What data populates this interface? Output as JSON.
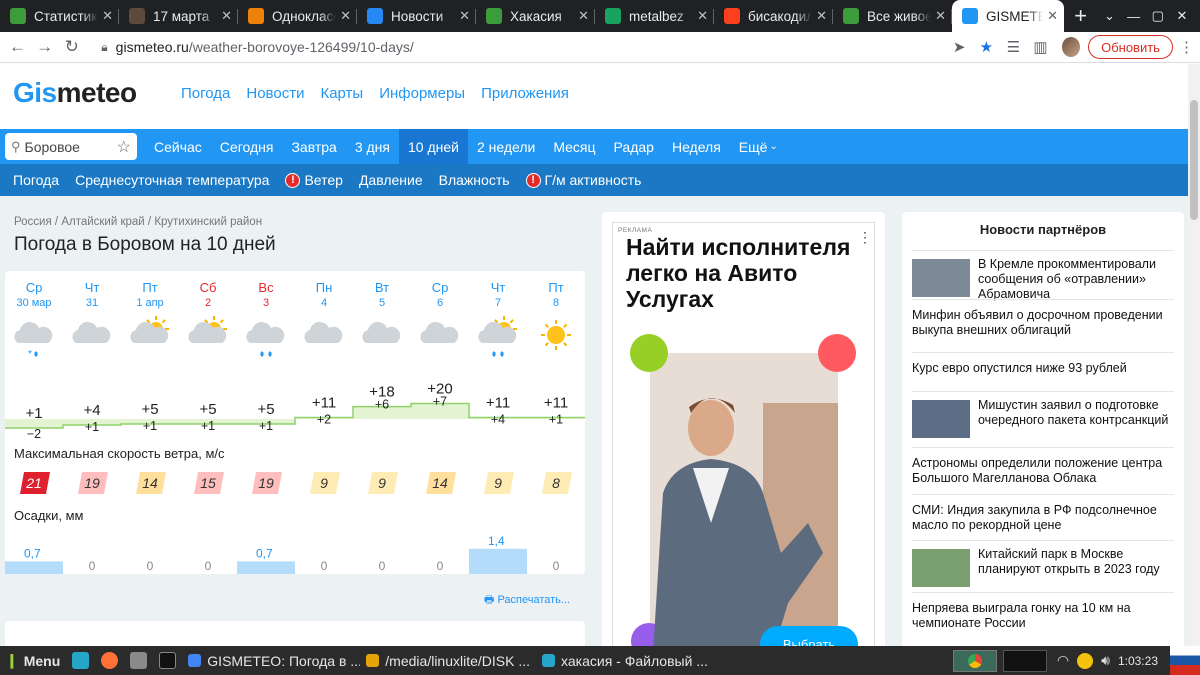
{
  "browser": {
    "tabs": [
      {
        "title": "Статистика",
        "icon": "green-ball-icon",
        "color": "#3c9c3c"
      },
      {
        "title": "17 марта",
        "icon": "photo-icon",
        "color": "#5c4a3a"
      },
      {
        "title": "Одноклассники",
        "icon": "ok-icon",
        "color": "#ee8208"
      },
      {
        "title": "Новости",
        "icon": "vk-icon",
        "color": "#2787f5"
      },
      {
        "title": "Хакасия",
        "icon": "green-ball-icon",
        "color": "#3c9c3c"
      },
      {
        "title": "metalbez",
        "icon": "check-icon",
        "color": "#1aa260"
      },
      {
        "title": "бисакодил",
        "icon": "yandex-icon",
        "color": "#fc3f1d"
      },
      {
        "title": "Все живое",
        "icon": "green-ball-icon",
        "color": "#3c9c3c"
      },
      {
        "title": "GISMETEO",
        "icon": "gismeteo-drop-icon",
        "color": "#2196f3",
        "active": true
      }
    ],
    "url_domain": "gismeteo.ru",
    "url_path": "/weather-borovoye-126499/10-days/",
    "update_button": "Обновить"
  },
  "site": {
    "logo_part1": "Gis",
    "logo_part2": "meteo",
    "nav": [
      "Погода",
      "Новости",
      "Карты",
      "Информеры",
      "Приложения"
    ],
    "search_value": "Боровое",
    "period_tabs": [
      "Сейчас",
      "Сегодня",
      "Завтра",
      "3 дня",
      "10 дней",
      "2 недели",
      "Месяц",
      "Радар",
      "Неделя",
      "Ещё"
    ],
    "active_period": "10 дней",
    "param_tabs": [
      {
        "label": "Погода",
        "warn": false
      },
      {
        "label": "Среднесуточная температура",
        "warn": false
      },
      {
        "label": "Ветер",
        "warn": true
      },
      {
        "label": "Давление",
        "warn": false
      },
      {
        "label": "Влажность",
        "warn": false
      },
      {
        "label": "Г/м активность",
        "warn": true
      }
    ],
    "breadcrumb": [
      "Россия",
      "Алтайский край",
      "Крутихинский район"
    ],
    "page_title": "Погода в Боровом на 10 дней",
    "wind_label": "Максимальная скорость ветра, м/с",
    "precip_label": "Осадки, мм",
    "print_label": "Распечатать..."
  },
  "chart_data": {
    "type": "table",
    "days": [
      {
        "dow": "Ср",
        "date": "30 мар",
        "weekend": false,
        "icon": "cloud-snow",
        "tmax": "+1",
        "tmin": "−2",
        "tmax_val": 1,
        "tmin_val": -2,
        "wind": "21",
        "precip": "0,7",
        "precip_val": 0.7
      },
      {
        "dow": "Чт",
        "date": "31",
        "weekend": false,
        "icon": "cloud",
        "tmax": "+4",
        "tmin": "+1",
        "tmax_val": 4,
        "tmin_val": 1,
        "wind": "19",
        "precip": "0",
        "precip_val": 0
      },
      {
        "dow": "Пт",
        "date": "1 апр",
        "weekend": false,
        "icon": "sun-cloud",
        "tmax": "+5",
        "tmin": "+1",
        "tmax_val": 5,
        "tmin_val": 1,
        "wind": "14",
        "precip": "0",
        "precip_val": 0
      },
      {
        "dow": "Сб",
        "date": "2",
        "weekend": true,
        "icon": "sun-cloud",
        "tmax": "+5",
        "tmin": "+1",
        "tmax_val": 5,
        "tmin_val": 1,
        "wind": "15",
        "precip": "0",
        "precip_val": 0
      },
      {
        "dow": "Вс",
        "date": "3",
        "weekend": true,
        "icon": "cloud-rain",
        "tmax": "+5",
        "tmin": "+1",
        "tmax_val": 5,
        "tmin_val": 1,
        "wind": "19",
        "precip": "0,7",
        "precip_val": 0.7
      },
      {
        "dow": "Пн",
        "date": "4",
        "weekend": false,
        "icon": "cloud",
        "tmax": "+11",
        "tmin": "+2",
        "tmax_val": 11,
        "tmin_val": 2,
        "wind": "9",
        "precip": "0",
        "precip_val": 0
      },
      {
        "dow": "Вт",
        "date": "5",
        "weekend": false,
        "icon": "cloud",
        "tmax": "+18",
        "tmin": "+6",
        "tmax_val": 18,
        "tmin_val": 6,
        "wind": "9",
        "precip": "0",
        "precip_val": 0
      },
      {
        "dow": "Ср",
        "date": "6",
        "weekend": false,
        "icon": "cloud",
        "tmax": "+20",
        "tmin": "+7",
        "tmax_val": 20,
        "tmin_val": 7,
        "wind": "14",
        "precip": "0",
        "precip_val": 0
      },
      {
        "dow": "Чт",
        "date": "7",
        "weekend": false,
        "icon": "sun-cloud-rain",
        "tmax": "+11",
        "tmin": "+4",
        "tmax_val": 11,
        "tmin_val": 4,
        "wind": "9",
        "precip": "1,4",
        "precip_val": 1.4
      },
      {
        "dow": "Пт",
        "date": "8",
        "weekend": false,
        "icon": "sun",
        "tmax": "+11",
        "tmin": "+1",
        "tmax_val": 11,
        "tmin_val": 1,
        "wind": "8",
        "precip": "0",
        "precip_val": 0
      }
    ],
    "colors": {
      "weekday": "#2196f3",
      "weekend": "#e32b2b",
      "temp_fill": "#e4f4d2",
      "temp_line": "#8fd16a",
      "precip_fill": "#b3dcfb"
    }
  },
  "ad": {
    "label": "РЕКЛАМА",
    "headline": "Найти исполнителя легко на Авито Услугах",
    "button": "Выбрать"
  },
  "news": {
    "heading": "Новости партнёров",
    "items": [
      {
        "text": "В Кремле прокомментировали сообщения об «отравлении» Абрамовича",
        "thumb": true
      },
      {
        "text": "Минфин объявил о досрочном проведении выкупа внешних облигаций",
        "thumb": false
      },
      {
        "text": "Курс евро опустился ниже 93 рублей",
        "thumb": false
      },
      {
        "text": "Мишустин заявил о подготовке очередного пакета контрсанкций",
        "thumb": true
      },
      {
        "text": "Астрономы определили положение центра Большого Магелланова Облака",
        "thumb": false
      },
      {
        "text": "СМИ: Индия закупила в РФ подсолнечное масло по рекордной цене",
        "thumb": false
      },
      {
        "text": "Китайский парк в Москве планируют открыть в 2023 году",
        "thumb": true
      },
      {
        "text": "Непряева выиграла гонку на 10 км на чемпионате России",
        "thumb": false
      }
    ]
  },
  "taskbar": {
    "menu": "Menu",
    "windows": [
      "GISMETEO: Погода в ...",
      "/media/linuxlite/DISK ...",
      "хакасия - Файловый ..."
    ],
    "clock": "1:03:23"
  }
}
